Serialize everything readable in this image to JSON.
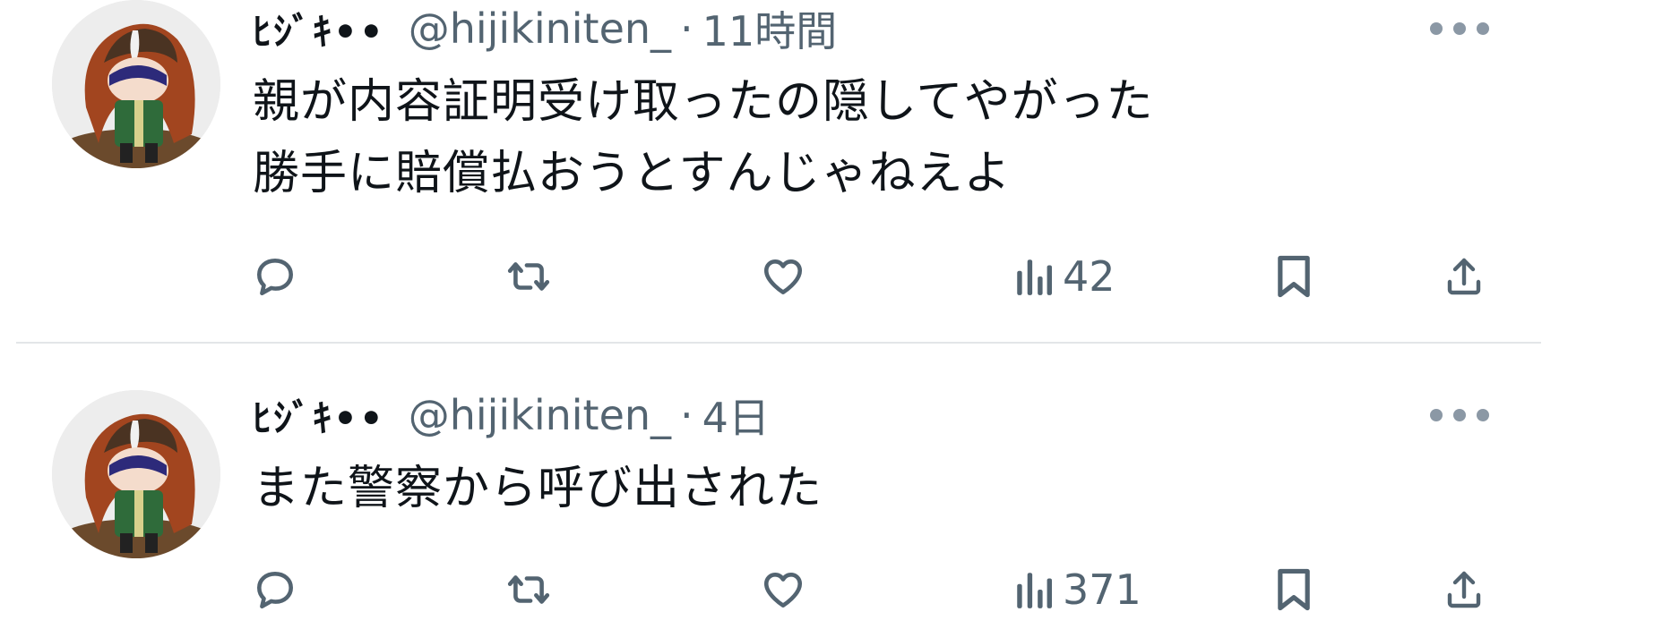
{
  "tweets": [
    {
      "display_name": "ﾋｼﾞｷ••",
      "handle": "@hijikiniten_",
      "separator": "·",
      "time": "11時間",
      "lines": [
        "親が内容証明受け取ったの隠してやがった",
        "勝手に賠償払おうとすんじゃねえよ"
      ],
      "views": "42"
    },
    {
      "display_name": "ﾋｼﾞｷ••",
      "handle": "@hijikiniten_",
      "separator": "·",
      "time": "4日",
      "lines": [
        "また警察から呼び出された"
      ],
      "views": "371"
    }
  ],
  "icons": {
    "more": "more-horizontal-icon",
    "reply": "reply-icon",
    "retweet": "retweet-icon",
    "like": "heart-icon",
    "views": "analytics-icon",
    "bookmark": "bookmark-icon",
    "share": "share-icon"
  },
  "colors": {
    "text_primary": "#0f1419",
    "text_secondary": "#536471",
    "divider": "#e3e6e8"
  }
}
